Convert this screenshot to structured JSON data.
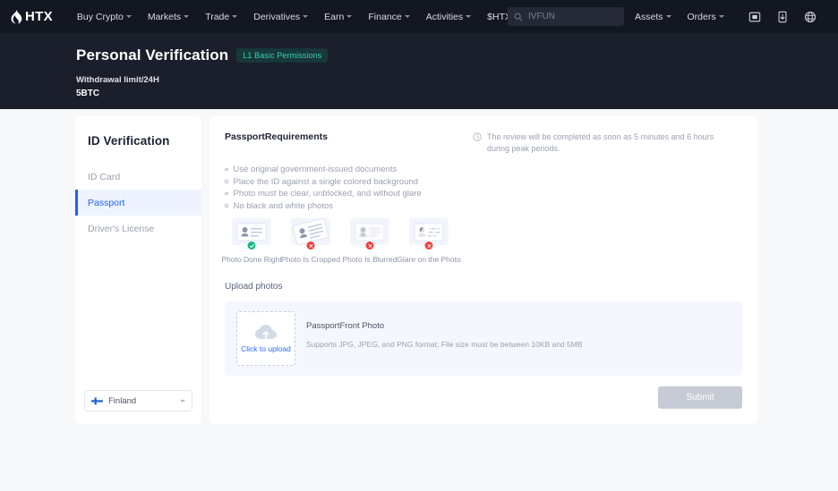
{
  "navbar": {
    "logo_text": "HTX",
    "logo_icon": "htx-flame-logo",
    "items": [
      {
        "label": "Buy Crypto",
        "has_caret": true
      },
      {
        "label": "Markets",
        "has_caret": true
      },
      {
        "label": "Trade",
        "has_caret": true
      },
      {
        "label": "Derivatives",
        "has_caret": true
      },
      {
        "label": "Earn",
        "has_caret": true
      },
      {
        "label": "Finance",
        "has_caret": true
      },
      {
        "label": "Activities",
        "has_caret": true
      },
      {
        "label": "$HTX Zone",
        "has_caret": true
      }
    ],
    "search": {
      "placeholder": "IVFUN",
      "icon": "search-icon"
    },
    "right_items": [
      {
        "label": "Assets",
        "has_caret": true
      },
      {
        "label": "Orders",
        "has_caret": true
      }
    ],
    "icons": [
      "app-download-icon",
      "download-icon",
      "globe-icon"
    ]
  },
  "header": {
    "title": "Personal Verification",
    "badge": "L1 Basic Permissions",
    "limit_label": "Withdrawal limit/24H",
    "limit_value": "5BTC"
  },
  "sidebar": {
    "title": "ID Verification",
    "items": [
      {
        "label": "ID Card",
        "active": false
      },
      {
        "label": "Passport",
        "active": true
      },
      {
        "label": "Driver's License",
        "active": false
      }
    ],
    "country": {
      "name": "Finland",
      "flag": "finland-flag"
    }
  },
  "main": {
    "requirements_title": "PassportRequirements",
    "notice": "The review will be completed as soon as 5 minutes and 6 hours during peak periods.",
    "requirements": [
      "Use original government-issued documents",
      "Place the ID against a single colored background",
      "Photo must be clear, unblocked, and without glare",
      "No black and white photos"
    ],
    "examples": [
      {
        "label": "Photo Done Right",
        "status": "ok",
        "variant": "good"
      },
      {
        "label": "Photo Is Cropped",
        "status": "bad",
        "variant": "cropped"
      },
      {
        "label": "Photo Is Blurred",
        "status": "bad",
        "variant": "blurred"
      },
      {
        "label": "Glare on the Photo",
        "status": "bad",
        "variant": "glare"
      }
    ],
    "upload_heading": "Upload photos",
    "upload": {
      "cta": "Click to upload",
      "title": "PassportFront Photo",
      "subtitle": "Supports JPG, JPEG, and PNG format; File size must be between 10KB and 5MB"
    },
    "submit_label": "Submit"
  },
  "colors": {
    "nav_bg": "#131722",
    "header_bg": "#1b1e2b",
    "page_bg": "#f7f8fa",
    "accent": "#1e61ff",
    "badge_bg": "#18383a",
    "badge_text": "#2fd2b5",
    "ok": "#12b886",
    "bad": "#f03e3e",
    "submit_disabled": "#c6cbd6"
  }
}
